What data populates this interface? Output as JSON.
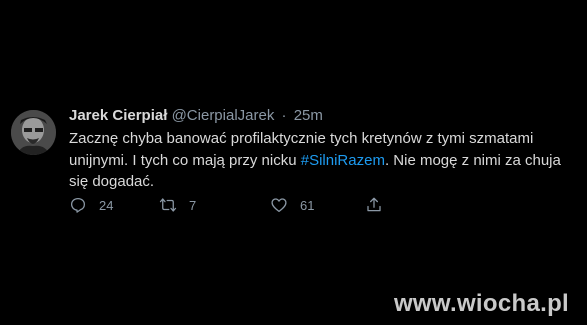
{
  "tweet": {
    "author_name": "Jarek Cierpiał",
    "author_handle": "@CierpialJarek",
    "separator": "·",
    "time": "25m",
    "text_part1": "Zacznę chyba banować profilaktycznie tych kretynów z tymi szmatami unijnymi. I tych co mają przy nicku ",
    "hashtag": "#SilniRazem",
    "text_part2": ". Nie mogę z nimi za chuja się dogadać.",
    "hashtag_color": "#1d9bf0",
    "actions": {
      "reply_count": "24",
      "retweet_count": "7",
      "like_count": "61"
    },
    "icons": {
      "reply": "reply-icon",
      "retweet": "retweet-icon",
      "like": "heart-icon",
      "share": "share-icon"
    }
  },
  "watermark": {
    "text": "www.wiocha.pl"
  }
}
